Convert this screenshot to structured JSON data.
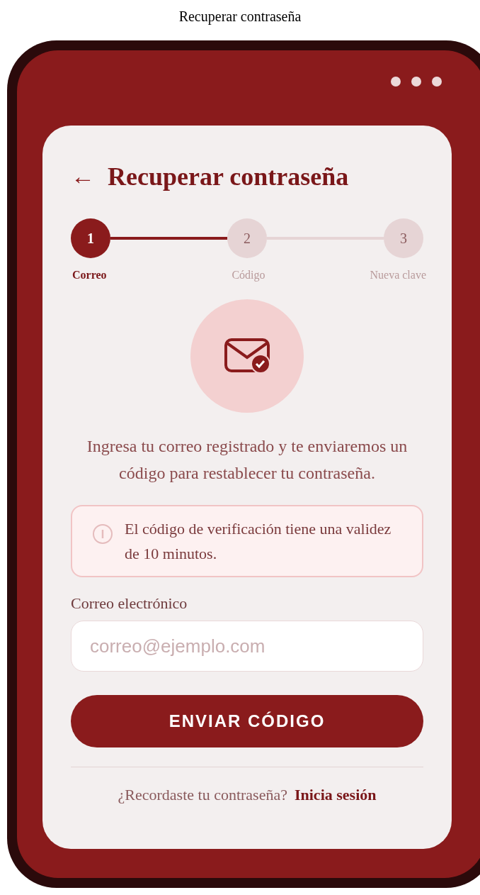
{
  "page_title": "Recuperar contraseña",
  "header": {
    "back": "←",
    "title": "Recuperar contraseña"
  },
  "stepper": {
    "connectors": [
      {
        "filled": true
      },
      {
        "filled": false
      }
    ],
    "steps": [
      {
        "number": "1",
        "label": "Correo",
        "selected": true
      },
      {
        "number": "2",
        "label": "Código",
        "selected": false
      },
      {
        "number": "3",
        "label": "Nueva clave",
        "selected": false
      }
    ]
  },
  "description": "Ingresa tu correo registrado y te enviaremos un código para restablecer tu contraseña.",
  "notice": "El código de verificación tiene una validez de 10 minutos.",
  "email_field": {
    "label": "Correo electrónico",
    "placeholder": "correo@ejemplo.com"
  },
  "submit_button": "ENVIAR CÓDIGO",
  "footer": {
    "text": "¿Recordaste tu contraseña?",
    "link": "Inicia sesión"
  }
}
